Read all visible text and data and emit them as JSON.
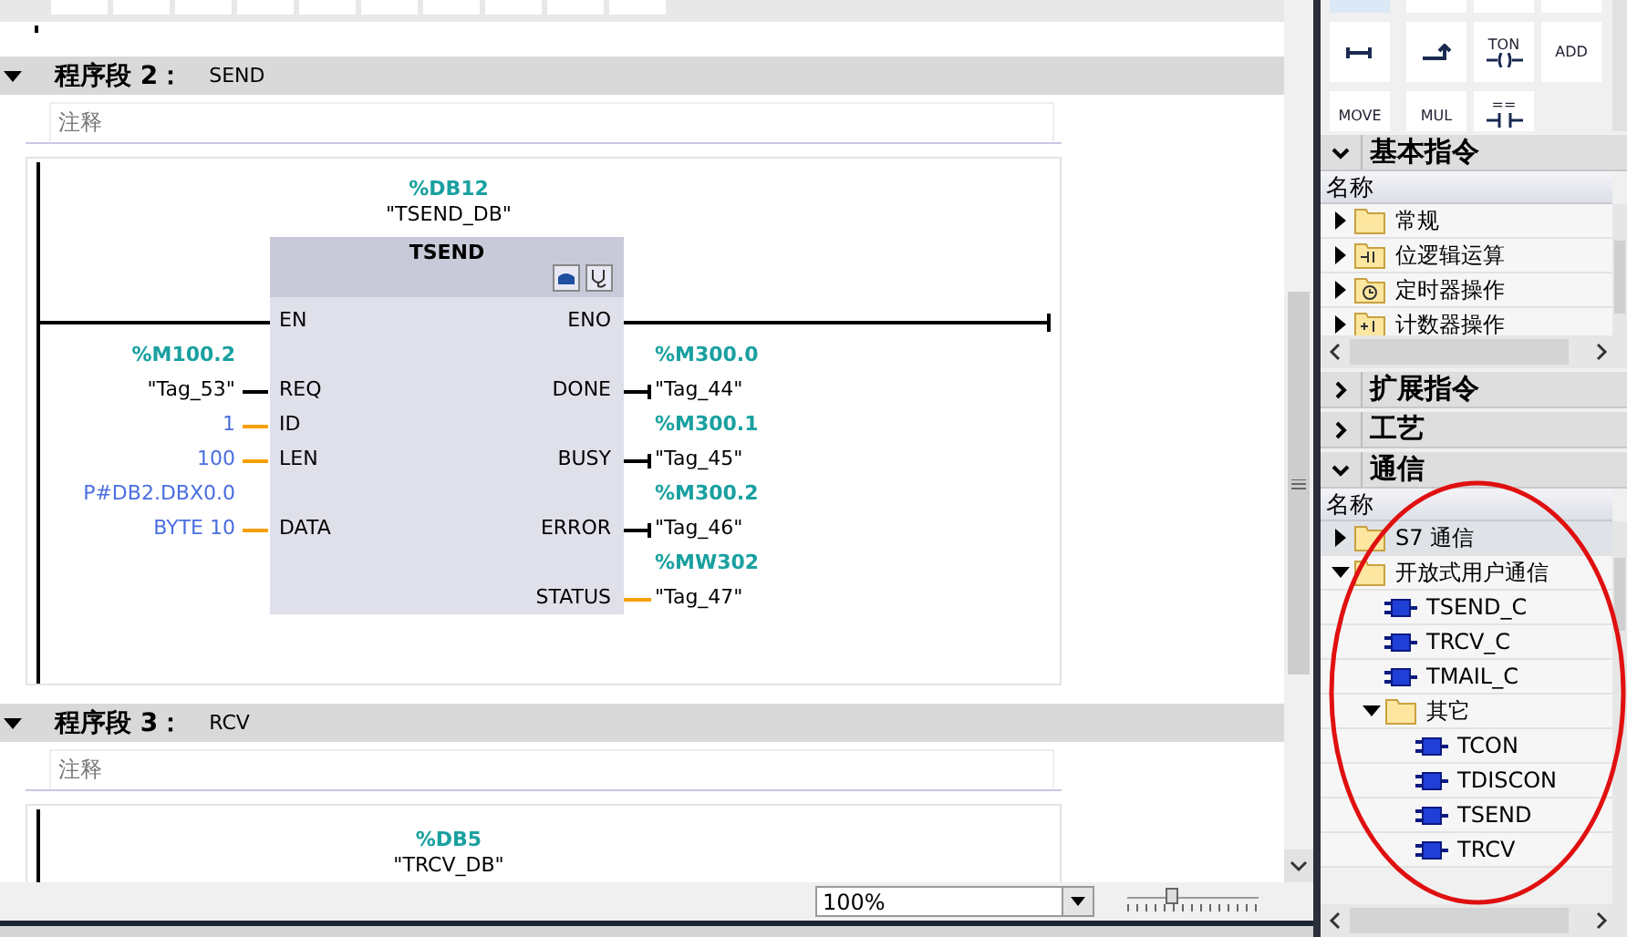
{
  "networks": [
    {
      "title": "程序段 2：",
      "name": "SEND",
      "expanded": true,
      "comment": {
        "placeholder": "注释"
      },
      "block": {
        "instance_address": "%DB12",
        "instance_name": "\"TSEND_DB\"",
        "type": "TSEND",
        "inputs": [
          {
            "pin": "EN",
            "kind": "power"
          },
          {
            "pin": "REQ",
            "kind": "bool",
            "address": "%M100.2",
            "operand": "\"Tag_53\""
          },
          {
            "pin": "ID",
            "kind": "constant",
            "operand": "1"
          },
          {
            "pin": "LEN",
            "kind": "constant",
            "operand": "100"
          },
          {
            "pin": "DATA",
            "kind": "constant",
            "address": "P#DB2.DBX0.0",
            "operand": "BYTE 10"
          }
        ],
        "outputs": [
          {
            "pin": "ENO",
            "kind": "power"
          },
          {
            "pin": "DONE",
            "kind": "bool",
            "address": "%M300.0",
            "operand": "\"Tag_44\""
          },
          {
            "pin": "BUSY",
            "kind": "bool",
            "address": "%M300.1",
            "operand": "\"Tag_45\""
          },
          {
            "pin": "ERROR",
            "kind": "bool",
            "address": "%M300.2",
            "operand": "\"Tag_46\""
          },
          {
            "pin": "STATUS",
            "kind": "word",
            "address": "%MW302",
            "operand": "\"Tag_47\""
          }
        ]
      }
    },
    {
      "title": "程序段 3：",
      "name": "RCV",
      "expanded": true,
      "comment": {
        "placeholder": "注释"
      },
      "block": {
        "instance_address": "%DB5",
        "instance_name": "\"TRCV_DB\""
      }
    }
  ],
  "zoom": {
    "value": "100%",
    "level": 0.33
  },
  "palette": [
    {
      "kind": "branch-open"
    },
    {
      "kind": "branch-close"
    },
    {
      "kind": "coil",
      "label": "TON"
    },
    {
      "kind": "box",
      "label": "ADD"
    },
    {
      "kind": "box",
      "label": "MOVE"
    },
    {
      "kind": "box",
      "label": "MUL"
    },
    {
      "kind": "contact",
      "label": "=="
    }
  ],
  "sections": [
    {
      "title": "基本指令",
      "expanded": true,
      "column": "名称",
      "items": [
        {
          "label": "常规",
          "kind": "folder",
          "expanded": false,
          "selected": false
        },
        {
          "label": "位逻辑运算",
          "kind": "bit-folder",
          "expanded": false,
          "selected": false
        },
        {
          "label": "定时器操作",
          "kind": "timer-folder",
          "expanded": false,
          "selected": false
        },
        {
          "label": "计数器操作",
          "kind": "counter-folder",
          "expanded": false,
          "selected": false
        }
      ]
    },
    {
      "title": "扩展指令",
      "expanded": false
    },
    {
      "title": "工艺",
      "expanded": false
    },
    {
      "title": "通信",
      "expanded": true,
      "column": "名称",
      "items": [
        {
          "label": "S7 通信",
          "kind": "folder",
          "expanded": false,
          "selected": true
        },
        {
          "label": "开放式用户通信",
          "kind": "folder",
          "expanded": true,
          "selected": false,
          "children": [
            {
              "label": "TSEND_C",
              "kind": "block",
              "selected": false
            },
            {
              "label": "TRCV_C",
              "kind": "block",
              "selected": false
            },
            {
              "label": "TMAIL_C",
              "kind": "block",
              "selected": false
            },
            {
              "label": "其它",
              "kind": "folder",
              "expanded": true,
              "selected": false,
              "children": [
                {
                  "label": "TCON",
                  "kind": "block",
                  "selected": false
                },
                {
                  "label": "TDISCON",
                  "kind": "block",
                  "selected": false
                },
                {
                  "label": "TSEND",
                  "kind": "block",
                  "selected": false
                },
                {
                  "label": "TRCV",
                  "kind": "block",
                  "selected": false
                }
              ]
            }
          ]
        }
      ]
    }
  ]
}
